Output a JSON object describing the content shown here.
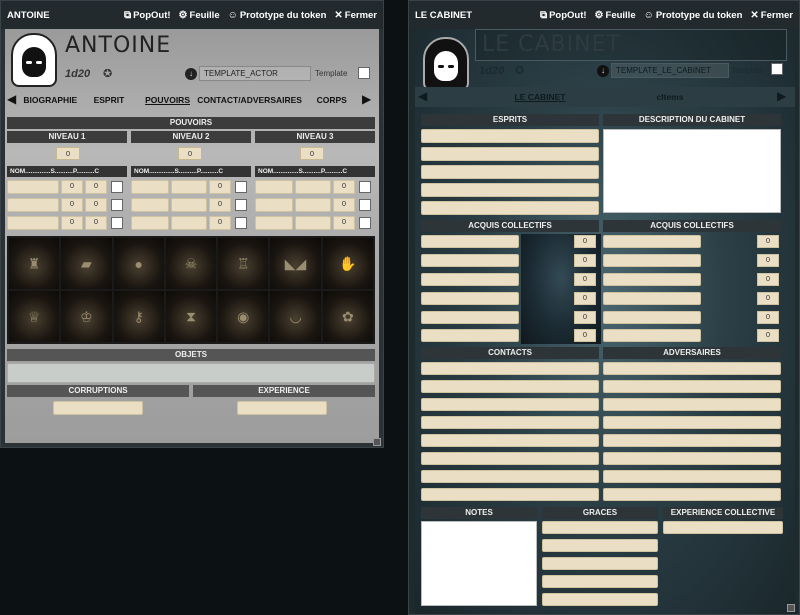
{
  "left_window": {
    "title": "ANTOINE",
    "actions": [
      {
        "icon": "external-link-icon",
        "label": "PopOut!"
      },
      {
        "icon": "gear-icon",
        "label": "Feuille"
      },
      {
        "icon": "user-circle-icon",
        "label": "Prototype du token"
      },
      {
        "icon": "close-icon",
        "label": "Fermer"
      }
    ],
    "name": "ANTOINE",
    "roll": "1d20",
    "template_value": "TEMPLATE_ACTOR",
    "template_label": "Template",
    "tabs": [
      "BIOGRAPHIE",
      "ESPRIT",
      "POUVOIRS",
      "CONTACT/ADVERSAIRES",
      "CORPS"
    ],
    "active_tab": "POUVOIRS",
    "section_title": "POUVOIRS",
    "levels": [
      {
        "label": "NIVEAU 1",
        "value": "0"
      },
      {
        "label": "NIVEAU 2",
        "value": "0"
      },
      {
        "label": "NIVEAU 3",
        "value": "0"
      }
    ],
    "col_header": "NOM..............S..........P..........C",
    "row_value": "0",
    "objets_title": "OBJETS",
    "corruptions_title": "CORRUPTIONS",
    "experience_title": "EXPERIENCE"
  },
  "right_window": {
    "title": "LE CABINET",
    "actions": [
      {
        "icon": "external-link-icon",
        "label": "PopOut!"
      },
      {
        "icon": "gear-icon",
        "label": "Feuille"
      },
      {
        "icon": "user-circle-icon",
        "label": "Prototype du token"
      },
      {
        "icon": "close-icon",
        "label": "Fermer"
      }
    ],
    "name": "LE CABINET",
    "roll": "1d20",
    "template_value": "TEMPLATE_LE_CABINET",
    "template_label": "Template",
    "tabs": [
      "LE CABINET",
      "cItems"
    ],
    "active_tab": "LE CABINET",
    "esprits_title": "ESPRITS",
    "description_title": "DESCRIPTION DU CABINET",
    "acquis_title_left": "ACQUIS COLLECTIFS",
    "acquis_title_right": "ACQUIS COLLECTIFS",
    "acquis_value": "0",
    "contacts_title": "CONTACTS",
    "adversaires_title": "ADVERSAIRES",
    "notes_title": "NOTES",
    "graces_title": "GRACES",
    "experience_title": "EXPERIENCE COLLECTIVE"
  },
  "colors": {
    "field_fill": "#eadfc4",
    "bar_fill": "#3c3c3c",
    "titlebar": "#232a2d"
  }
}
